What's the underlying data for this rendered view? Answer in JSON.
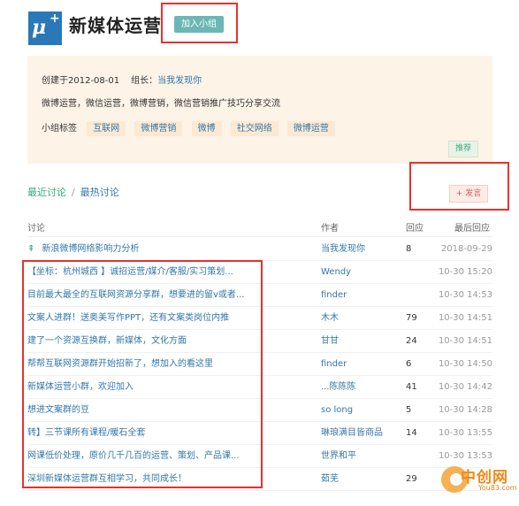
{
  "header": {
    "logo_main": "μ",
    "logo_plus": "+",
    "title": "新媒体运营",
    "join_label": "加入小组"
  },
  "info": {
    "created": "创建于2012-08-01",
    "owner_label": "组长：",
    "owner": "当我发现你",
    "description": "微博运营，微信运营，微博营销，微信营销推广技巧分享交流",
    "tags_label": "小组标签",
    "tags": [
      "互联网",
      "微博营销",
      "微博",
      "社交网络",
      "微博运营"
    ],
    "recommend_label": "推荐"
  },
  "tabs": {
    "latest": "最近讨论",
    "separator": "/",
    "hot": "最热讨论"
  },
  "post_button": "+ 发言",
  "columns": {
    "topic": "讨论",
    "author": "作者",
    "replies": "回应",
    "last_reply": "最后回应"
  },
  "rows": [
    {
      "pin": "⇞",
      "title": "新浪微博网络影响力分析",
      "author": "当我发现你",
      "replies": "8",
      "time": "2018-09-29"
    },
    {
      "title": "【坐标：杭州城西 】诚招运营/媒介/客服/实习策划...",
      "author": "Wendy",
      "replies": "",
      "time": "10-30 15:20"
    },
    {
      "title": "目前最大最全的互联网资源分享群，想要进的留v或者...",
      "author": "finder",
      "replies": "",
      "time": "10-30 14:53"
    },
    {
      "title": "文案人进群！送奥美写作PPT，还有文案类岗位内推",
      "author": "木木",
      "replies": "79",
      "time": "10-30 14:51"
    },
    {
      "title": "建了一个资源互换群，新媒体，文化方面",
      "author": "甘甘",
      "replies": "24",
      "time": "10-30 14:51"
    },
    {
      "title": "帮帮互联网资源群开始招新了，想加入的看这里",
      "author": "finder",
      "replies": "6",
      "time": "10-30 14:50"
    },
    {
      "title": "新媒体运营小群，欢迎加入",
      "author": "...陈陈陈",
      "replies": "41",
      "time": "10-30 14:42"
    },
    {
      "title": "想进文案群的豆",
      "author": "so long",
      "replies": "5",
      "time": "10-30 14:28"
    },
    {
      "title": "转】三节课所有课程/暖石全套",
      "author": "琳琅满目皆商品",
      "replies": "14",
      "time": "10-30 13:55"
    },
    {
      "title": "网课低价处理，原价几千几百的运营、策划、产品课...",
      "author": "世界和平",
      "replies": "",
      "time": "10-30 13:53"
    },
    {
      "title": "深圳新媒体运营群互相学习，共同成长！",
      "author": "茹芜",
      "replies": "29",
      "time": ""
    }
  ],
  "watermark": {
    "name": "中创网",
    "url": "You83.com"
  },
  "colors": {
    "accent": "#6bb7b5",
    "link": "#3377aa",
    "highlight": "#e8312f",
    "panel": "#fdf3e7"
  }
}
